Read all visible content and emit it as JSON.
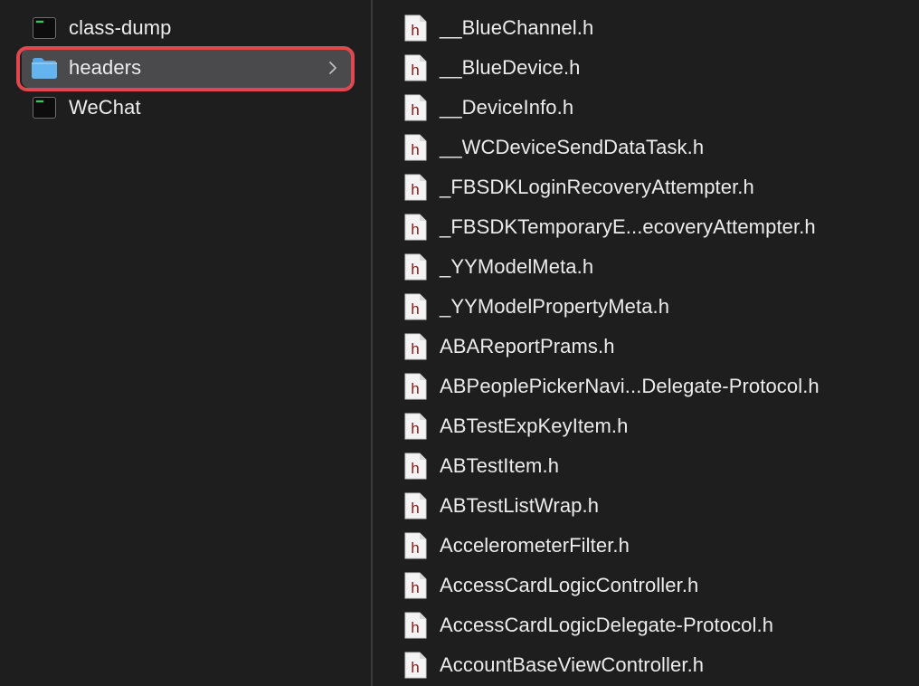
{
  "window": {
    "view_mode": "column-view",
    "colors": {
      "background": "#1e1e1e",
      "selection": "#4a4a4c",
      "highlight_border": "#e0474f",
      "text": "#ececec",
      "header_letter": "#8b1a1a"
    }
  },
  "left_column": {
    "items": [
      {
        "label": "class-dump",
        "icon": "unix-executable-icon",
        "selected": false
      },
      {
        "label": "headers",
        "icon": "folder-icon",
        "selected": true,
        "has_chevron": true
      },
      {
        "label": "WeChat",
        "icon": "unix-executable-icon",
        "selected": false
      }
    ]
  },
  "right_column": {
    "icon": "header-file-icon",
    "items": [
      {
        "label": "__BlueChannel.h"
      },
      {
        "label": "__BlueDevice.h"
      },
      {
        "label": "__DeviceInfo.h"
      },
      {
        "label": "__WCDeviceSendDataTask.h"
      },
      {
        "label": "_FBSDKLoginRecoveryAttempter.h"
      },
      {
        "label": "_FBSDKTemporaryE...ecoveryAttempter.h"
      },
      {
        "label": "_YYModelMeta.h"
      },
      {
        "label": "_YYModelPropertyMeta.h"
      },
      {
        "label": "ABAReportPrams.h"
      },
      {
        "label": "ABPeoplePickerNavi...Delegate-Protocol.h"
      },
      {
        "label": "ABTestExpKeyItem.h"
      },
      {
        "label": "ABTestItem.h"
      },
      {
        "label": "ABTestListWrap.h"
      },
      {
        "label": "AccelerometerFilter.h"
      },
      {
        "label": "AccessCardLogicController.h"
      },
      {
        "label": "AccessCardLogicDelegate-Protocol.h"
      },
      {
        "label": "AccountBaseViewController.h"
      }
    ]
  }
}
